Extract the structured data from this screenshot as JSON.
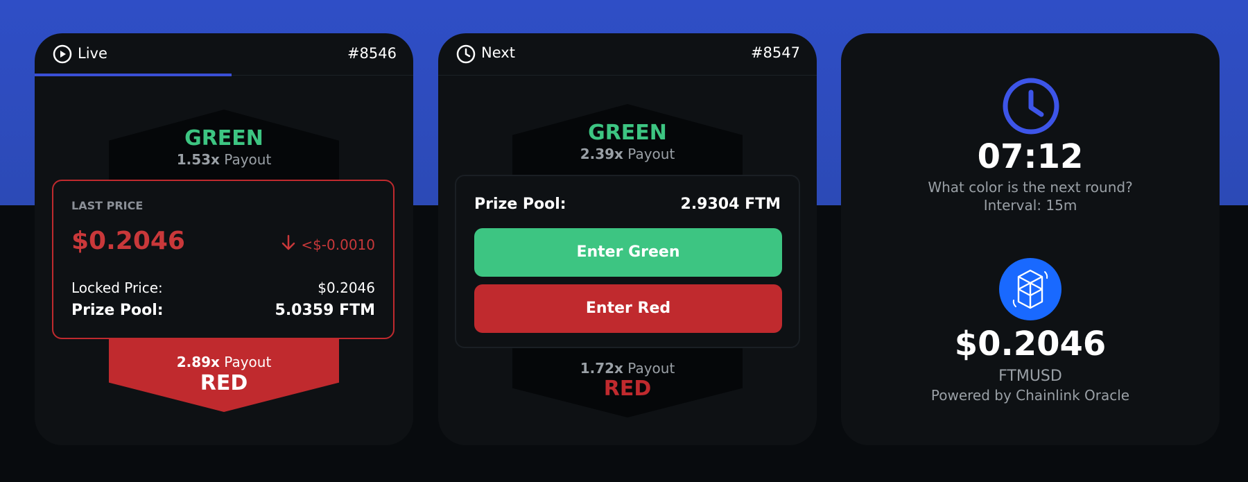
{
  "colors": {
    "accent": "#3a4fd6",
    "green": "#3dc582",
    "red": "#c02a2e",
    "band": "#2f4ec6",
    "card": "#0e1114",
    "background": "#080b0e"
  },
  "live": {
    "status_icon": "play-circle-icon",
    "status": "Live",
    "round": "#8546",
    "progress": 0.52,
    "green_label": "GREEN",
    "green_multiplier": "1.53x",
    "green_payout_word": "Payout",
    "last_price_caption": "LAST PRICE",
    "last_price": "$0.2046",
    "change_icon": "arrow-down-icon",
    "change": "<$-0.0010",
    "locked_label": "Locked Price:",
    "locked_value": "$0.2046",
    "prize_label": "Prize Pool:",
    "prize_value": "5.0359 FTM",
    "red_multiplier": "2.89x",
    "red_payout_word": "Payout",
    "red_label": "RED"
  },
  "next": {
    "status_icon": "clock-icon",
    "status": "Next",
    "round": "#8547",
    "green_label": "GREEN",
    "green_multiplier": "2.39x",
    "green_payout_word": "Payout",
    "prize_label": "Prize Pool:",
    "prize_value": "2.9304 FTM",
    "enter_green": "Enter Green",
    "enter_red": "Enter Red",
    "red_multiplier": "1.72x",
    "red_payout_word": "Payout",
    "red_label": "RED"
  },
  "info": {
    "timer_icon": "clock-icon",
    "timer": "07:12",
    "question": "What color is the next round?",
    "interval": "Interval: 15m",
    "token_icon": "fantom-logo-icon",
    "price": "$0.2046",
    "pair": "FTMUSD",
    "powered_by": "Powered by Chainlink Oracle"
  }
}
